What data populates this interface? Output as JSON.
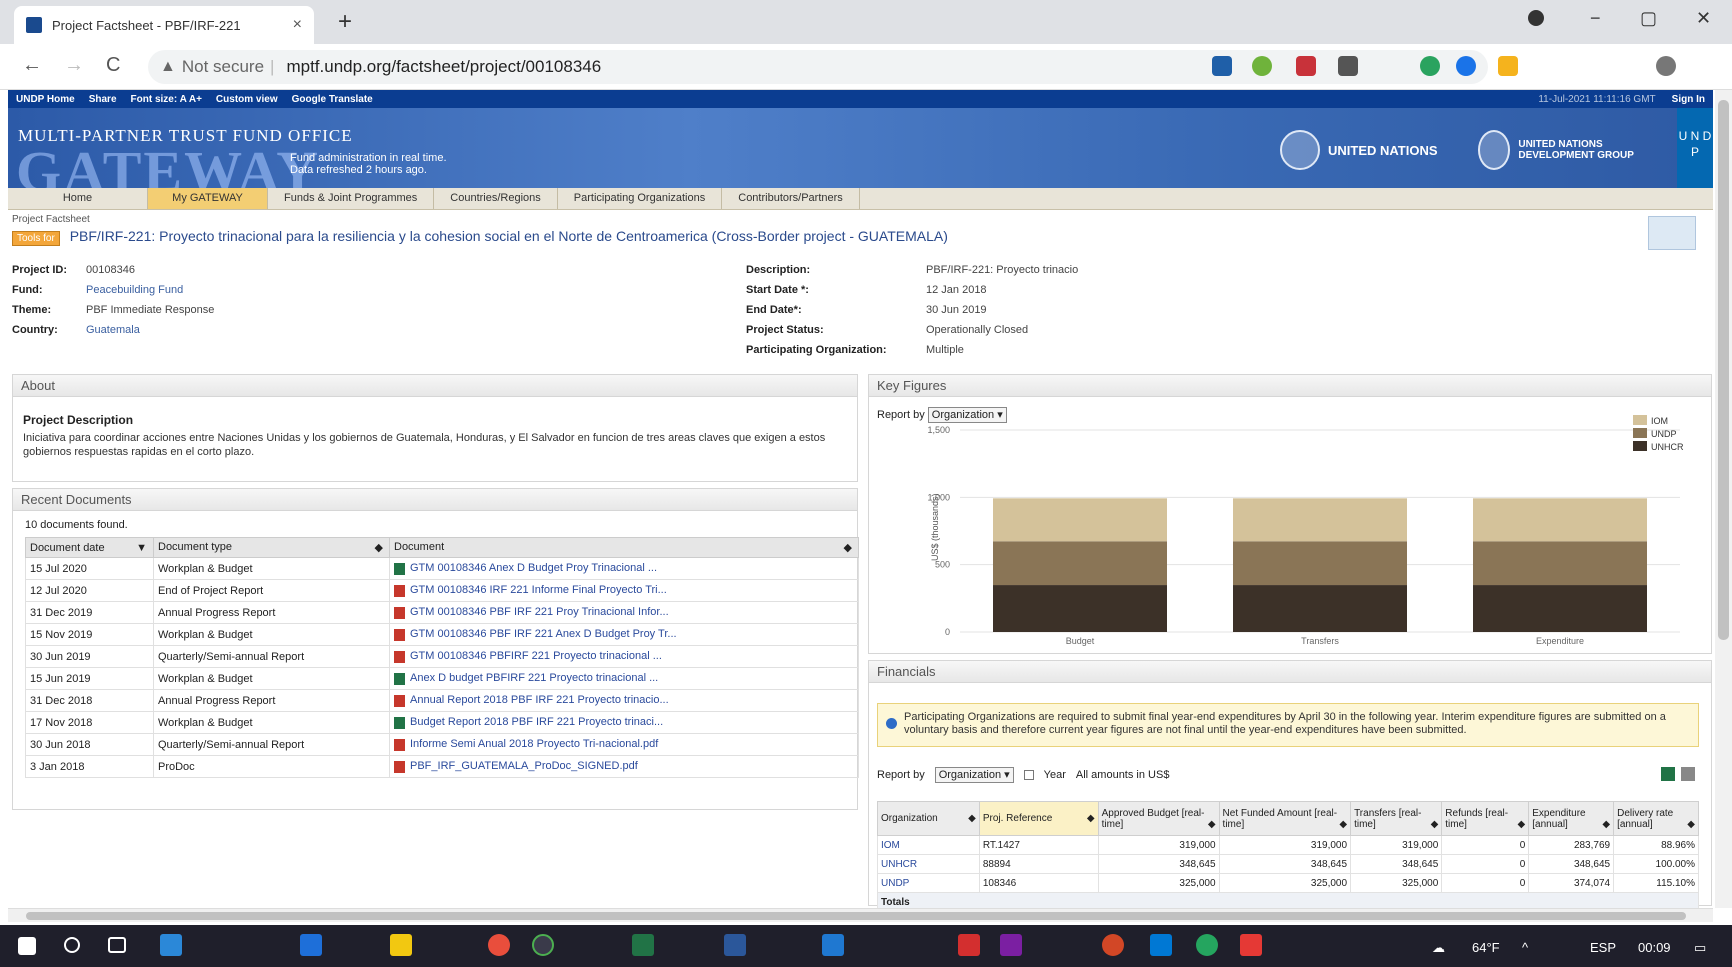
{
  "browser": {
    "tab_title": "Project Factsheet - PBF/IRF-221",
    "tab_close": "×",
    "new_tab": "+",
    "not_secure": "Not secure",
    "url": "mptf.undp.org/factsheet/project/00108346",
    "nav": {
      "back": "←",
      "forward": "→",
      "reload": "C"
    },
    "window": {
      "minimize": "−",
      "restore": "▢",
      "close": "✕"
    }
  },
  "topbar": {
    "links": [
      "UNDP Home",
      "Share",
      "Font size: A A+",
      "Custom view",
      "Google Translate"
    ],
    "right": [
      "11-Jul-2021 11:11:16 GMT",
      "Sign In"
    ]
  },
  "banner": {
    "title": "MULTI-PARTNER TRUST FUND OFFICE",
    "big": "GATEWAY",
    "tag1": "Fund administration in real time.",
    "tag2": "Data refreshed 2 hours ago.",
    "un": "UNITED NATIONS",
    "undg": "UNITED NATIONS DEVELOPMENT GROUP",
    "undp": "U N D P"
  },
  "nav_tabs": [
    "Home",
    "My GATEWAY",
    "Funds & Joint Programmes",
    "Countries/Regions",
    "Participating Organizations",
    "Contributors/Partners"
  ],
  "project": {
    "breadcrumb": "Project Factsheet",
    "badge": "Tools for",
    "title": "PBF/IRF-221: Proyecto trinacional para la resiliencia y la cohesion social en el Norte de Centroamerica (Cross-Border project - GUATEMALA)",
    "left": [
      {
        "label": "Project ID:",
        "value": "00108346"
      },
      {
        "label": "Fund:",
        "value": "Peacebuilding Fund"
      },
      {
        "label": "Theme:",
        "value": "PBF Immediate Response"
      },
      {
        "label": "Country:",
        "value": "Guatemala"
      }
    ],
    "right": [
      {
        "label": "Description:",
        "value": "PBF/IRF-221: Proyecto trinacio"
      },
      {
        "label": "Start Date *:",
        "value": "12 Jan 2018"
      },
      {
        "label": "End Date*:",
        "value": "30 Jun 2019"
      },
      {
        "label": "Project Status:",
        "value": "Operationally Closed"
      },
      {
        "label": "Participating Organization:",
        "value": "Multiple"
      }
    ]
  },
  "about": {
    "header": "About",
    "desc_title": "Project Description",
    "desc_text": "Iniciativa para coordinar acciones entre Naciones Unidas y los gobiernos de Guatemala, Honduras, y El Salvador en funcion de tres areas claves que exigen a estos gobiernos respuestas rapidas en el corto plazo."
  },
  "documents": {
    "header": "Recent Documents",
    "found": "10 documents found.",
    "columns": [
      "Document date",
      "Document type",
      "Document"
    ],
    "rows": [
      {
        "date": "15 Jul 2020",
        "type": "Workplan & Budget",
        "doc": "GTM 00108346 Anex D Budget Proy Trinacional ...",
        "icon": "xls"
      },
      {
        "date": "12 Jul 2020",
        "type": "End of Project Report",
        "doc": "GTM 00108346 IRF 221 Informe Final Proyecto Tri...",
        "icon": "pdf"
      },
      {
        "date": "31 Dec 2019",
        "type": "Annual Progress Report",
        "doc": "GTM 00108346 PBF IRF 221 Proy Trinacional Infor...",
        "icon": "pdf"
      },
      {
        "date": "15 Nov 2019",
        "type": "Workplan & Budget",
        "doc": "GTM 00108346 PBF IRF 221 Anex D Budget Proy Tr...",
        "icon": "pdf"
      },
      {
        "date": "30 Jun 2019",
        "type": "Quarterly/Semi-annual Report",
        "doc": "GTM 00108346 PBFIRF 221 Proyecto trinacional ...",
        "icon": "pdf"
      },
      {
        "date": "15 Jun 2019",
        "type": "Workplan & Budget",
        "doc": "Anex D budget PBFIRF 221 Proyecto trinacional ...",
        "icon": "xls"
      },
      {
        "date": "31 Dec 2018",
        "type": "Annual Progress Report",
        "doc": "Annual Report 2018 PBF IRF 221 Proyecto trinacio...",
        "icon": "pdf"
      },
      {
        "date": "17 Nov 2018",
        "type": "Workplan & Budget",
        "doc": "Budget Report 2018 PBF IRF 221 Proyecto trinaci...",
        "icon": "xls"
      },
      {
        "date": "30 Jun 2018",
        "type": "Quarterly/Semi-annual Report",
        "doc": "Informe Semi Anual 2018 Proyecto Tri-nacional.pdf",
        "icon": "pdf"
      },
      {
        "date": "3 Jan 2018",
        "type": "ProDoc",
        "doc": "PBF_IRF_GUATEMALA_ProDoc_SIGNED.pdf",
        "icon": "pdf"
      }
    ]
  },
  "key_figures": {
    "header": "Key Figures",
    "report_by": "Report by",
    "report_select": "Organization"
  },
  "chart_data": {
    "type": "bar",
    "stacked": true,
    "categories": [
      "Budget",
      "Transfers",
      "Expenditure"
    ],
    "series": [
      {
        "name": "IOM",
        "values": [
          319000,
          319000,
          319000
        ],
        "color": "#d4c29a"
      },
      {
        "name": "UNDP",
        "values": [
          325000,
          325000,
          325000
        ],
        "color": "#8a7556"
      },
      {
        "name": "UNHCR",
        "values": [
          348645,
          348645,
          348645
        ],
        "color": "#3c3128"
      }
    ],
    "ylabel": "US$ (thousands)",
    "yticks": [
      "0",
      "500",
      "1,000",
      "1,500"
    ],
    "ylim": [
      0,
      1500000
    ],
    "legend_position": "top-right",
    "grid": true
  },
  "financials": {
    "header": "Financials",
    "note": "Participating Organizations are required to submit final year-end expenditures by April 30 in the following year. Interim expenditure figures are submitted on a voluntary basis and therefore current year figures are not final until the year-end expenditures have been submitted.",
    "report_by": "Report by",
    "report_select": "Organization",
    "year_label": "Year",
    "amounts_label": "All amounts in US$",
    "columns": [
      "Organization",
      "Proj. Reference",
      "Approved Budget [real-time]",
      "Net Funded Amount [real-time]",
      "Transfers [real-time]",
      "Refunds [real-time]",
      "Expenditure [annual]",
      "Delivery rate [annual]"
    ],
    "rows": [
      {
        "org": "IOM",
        "ref": "RT.1427",
        "budget": "319,000",
        "net": "319,000",
        "transfers": "319,000",
        "refunds": "0",
        "exp": "283,769",
        "rate": "88.96%"
      },
      {
        "org": "UNHCR",
        "ref": "88894",
        "budget": "348,645",
        "net": "348,645",
        "transfers": "348,645",
        "refunds": "0",
        "exp": "348,645",
        "rate": "100.00%"
      },
      {
        "org": "UNDP",
        "ref": "108346",
        "budget": "325,000",
        "net": "325,000",
        "transfers": "325,000",
        "refunds": "0",
        "exp": "374,074",
        "rate": "115.10%"
      }
    ],
    "totals": "Totals"
  },
  "taskbar": {
    "weather": "64°F",
    "lang": "ESP",
    "time": "00:09"
  },
  "colors": {
    "nav_active": "#f3ce73",
    "link": "#2a4a9c",
    "banner": "#3a6ab5"
  }
}
